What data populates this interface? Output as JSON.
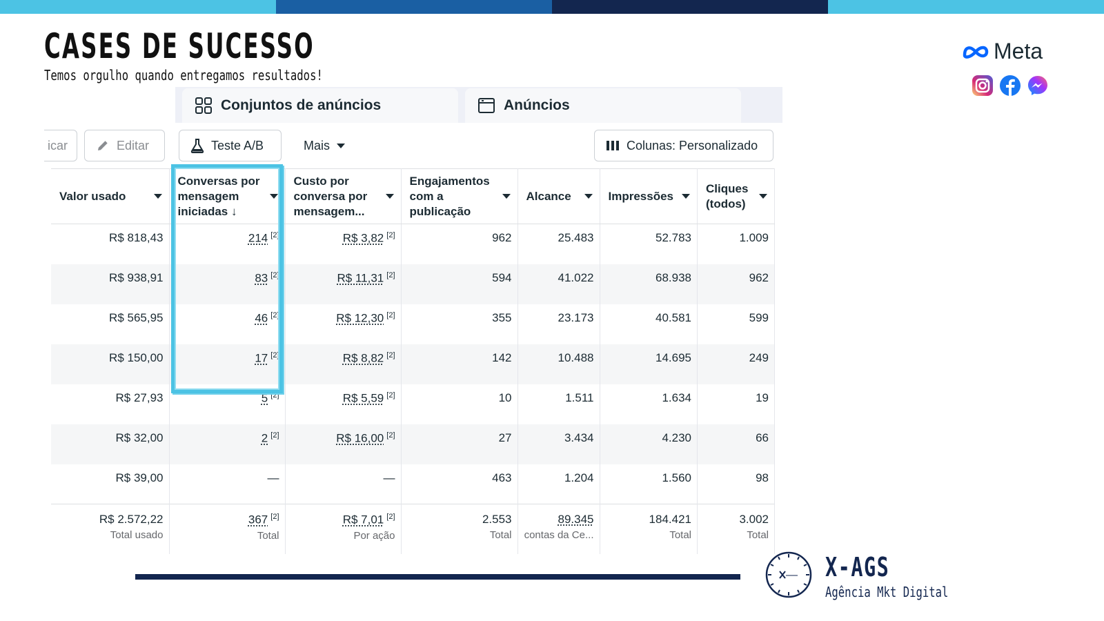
{
  "topbar_colors": [
    "#4cc3e4",
    "#1a5fa3",
    "#13264f",
    "#4cc3e4"
  ],
  "header": {
    "title": "CASES DE SUCESSO",
    "subtitle": "Temos orgulho quando entregamos resultados!"
  },
  "meta": {
    "label": "Meta"
  },
  "tabs": [
    {
      "label": "Conjuntos de anúncios",
      "icon": "grid-icon"
    },
    {
      "label": "Anúncios",
      "icon": "ad-window-icon"
    }
  ],
  "toolbar": {
    "duplicate_label": "icar",
    "edit_label": "Editar",
    "ab_test_label": "Teste A/B",
    "more_label": "Mais",
    "columns_label": "Colunas: Personalizado"
  },
  "table": {
    "headers": [
      "Valor usado",
      "Conversas por mensagem iniciadas ↓",
      "Custo por conversa por mensagem...",
      "Engajamentos com a publicação",
      "Alcance",
      "Impressões",
      "Cliques (todos)"
    ],
    "rows": [
      [
        "R$ 818,43",
        "214",
        "R$ 3,82",
        "962",
        "25.483",
        "52.783",
        "1.009"
      ],
      [
        "R$ 938,91",
        "83",
        "R$ 11,31",
        "594",
        "41.022",
        "68.938",
        "962"
      ],
      [
        "R$ 565,95",
        "46",
        "R$ 12,30",
        "355",
        "23.173",
        "40.581",
        "599"
      ],
      [
        "R$ 150,00",
        "17",
        "R$ 8,82",
        "142",
        "10.488",
        "14.695",
        "249"
      ],
      [
        "R$ 27,93",
        "5",
        "R$ 5,59",
        "10",
        "1.511",
        "1.634",
        "19"
      ],
      [
        "R$ 32,00",
        "2",
        "R$ 16,00",
        "27",
        "3.434",
        "4.230",
        "66"
      ],
      [
        "R$ 39,00",
        "—",
        "—",
        "463",
        "1.204",
        "1.560",
        "98"
      ]
    ],
    "sup_mark": "[2]",
    "totals": [
      "R$ 2.572,22",
      "367",
      "R$ 7,01",
      "2.553",
      "89.345",
      "184.421",
      "3.002"
    ],
    "total_labels": [
      "Total usado",
      "Total",
      "Por ação",
      "Total",
      "contas da Ce...",
      "Total",
      "Total"
    ]
  },
  "brand": {
    "name": "X-AGS",
    "tagline": "Agência Mkt Digital"
  }
}
